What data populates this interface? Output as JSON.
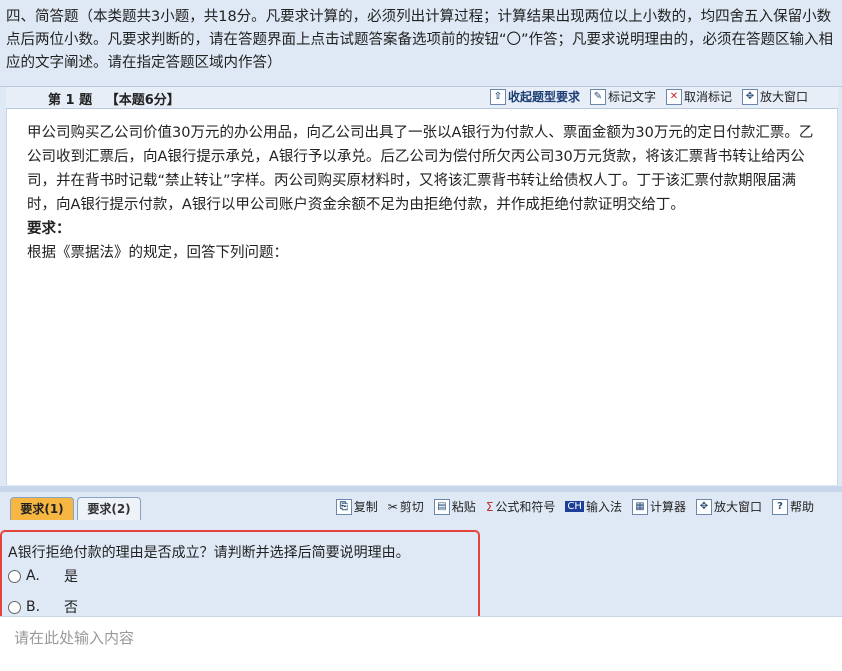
{
  "section": {
    "instructions": "四、简答题（本类题共3小题，共18分。凡要求计算的，必须列出计算过程；计算结果出现两位以上小数的，均四舍五入保留小数点后两位小数。凡要求判断的，请在答题界面上点击试题答案备选项前的按钮“〇”作答；凡要求说明理由的，必须在答题区输入相应的文字阐述。请在指定答题区域内作答）"
  },
  "question_bar": {
    "number": "第 1 题",
    "score": "【本题6分】",
    "tools": [
      {
        "label": "收起题型要求",
        "icon": "collapse-icon"
      },
      {
        "label": "标记文字",
        "icon": "mark-text-icon"
      },
      {
        "label": "取消标记",
        "icon": "unmark-icon"
      },
      {
        "label": "放大窗口",
        "icon": "enlarge-icon"
      }
    ]
  },
  "question": {
    "body": "甲公司购买乙公司价值30万元的办公用品，向乙公司出具了一张以A银行为付款人、票面金额为30万元的定日付款汇票。乙公司收到汇票后，向A银行提示承兑，A银行予以承兑。后乙公司为偿付所欠丙公司30万元货款，将该汇票背书转让给丙公司，并在背书时记载“禁止转让”字样。丙公司购买原材料时，又将该汇票背书转让给债权人丁。丁于该汇票付款期限届满时，向A银行提示付款，A银行以甲公司账户资金余额不足为由拒绝付款，并作成拒绝付款证明交给丁。",
    "req_label": "要求：",
    "req_text": "根据《票据法》的规定，回答下列问题："
  },
  "answer_tabs": [
    "要求(1)",
    "要求(2)"
  ],
  "answer_tools": [
    {
      "label": "复制",
      "icon": "copy-icon"
    },
    {
      "label": "剪切",
      "icon": "cut-icon"
    },
    {
      "label": "粘贴",
      "icon": "paste-icon"
    },
    {
      "label": "公式和符号",
      "icon": "sigma-icon"
    },
    {
      "label": "输入法",
      "icon": "ime-icon"
    },
    {
      "label": "计算器",
      "icon": "calculator-icon"
    },
    {
      "label": "放大窗口",
      "icon": "enlarge-icon"
    },
    {
      "label": "帮助",
      "icon": "help-icon"
    }
  ],
  "sub_question": {
    "text": "A银行拒绝付款的理由是否成立？请判断并选择后简要说明理由。",
    "options": [
      {
        "key": "A.",
        "label": "是"
      },
      {
        "key": "B.",
        "label": "否"
      }
    ]
  },
  "answer_input": {
    "placeholder": "请在此处输入内容"
  }
}
